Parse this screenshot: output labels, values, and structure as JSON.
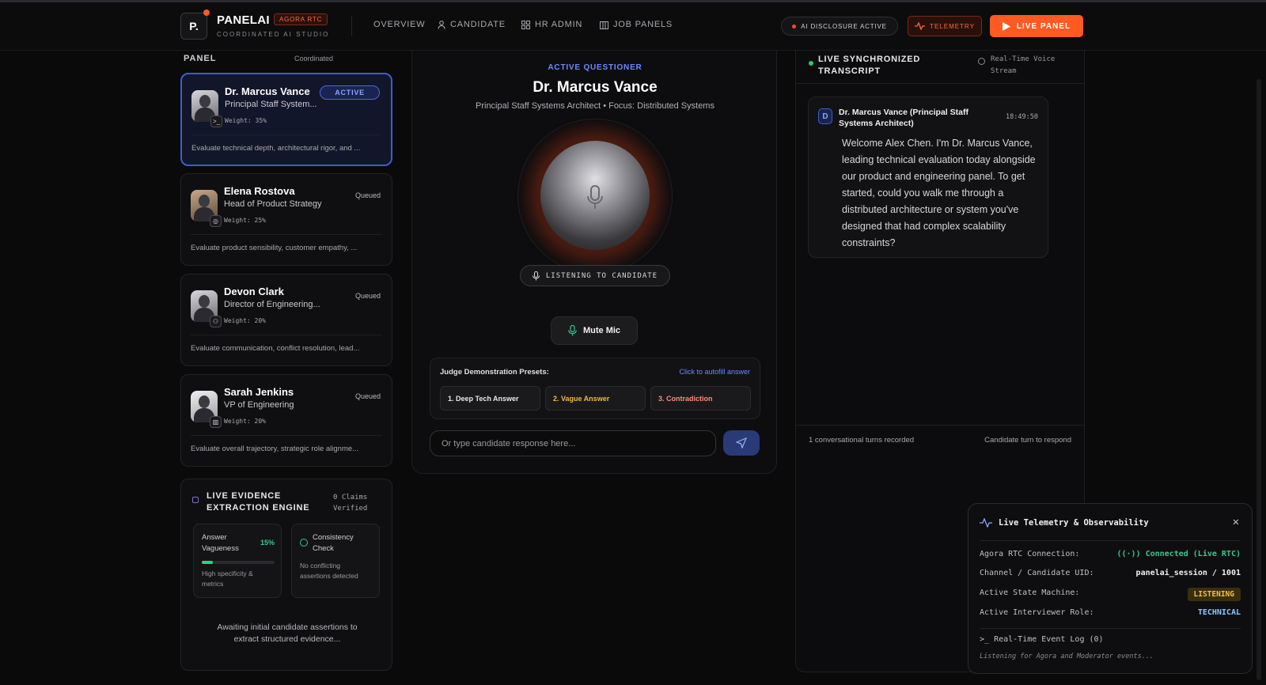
{
  "header": {
    "logo_mark": "P.",
    "brand": "PANELAI",
    "badge": "AGORA RTC",
    "subtitle": "COORDINATED AI STUDIO",
    "nav": [
      "OVERVIEW",
      "CANDIDATE",
      "HR ADMIN",
      "JOB PANELS"
    ],
    "disclosure": "AI DISCLOSURE ACTIVE",
    "telemetry_btn": "TELEMETRY",
    "live_btn": "LIVE PANEL"
  },
  "panel": {
    "title": "PANEL",
    "mode": "Coordinated",
    "members": [
      {
        "name": "Dr. Marcus Vance",
        "role": "Principal Staff System...",
        "weight": "Weight: 35%",
        "status": "ACTIVE",
        "desc": "Evaluate technical depth, architectural rigor, and ...",
        "badge_icon": "terminal-icon"
      },
      {
        "name": "Elena Rostova",
        "role": "Head of Product Strategy",
        "weight": "Weight: 25%",
        "status": "Queued",
        "desc": "Evaluate product sensibility, customer empathy, ...",
        "badge_icon": "target-icon"
      },
      {
        "name": "Devon Clark",
        "role": "Director of Engineering...",
        "weight": "Weight: 20%",
        "status": "Queued",
        "desc": "Evaluate communication, conflict resolution, lead...",
        "badge_icon": "users-icon"
      },
      {
        "name": "Sarah Jenkins",
        "role": "VP of Engineering",
        "weight": "Weight: 20%",
        "status": "Queued",
        "desc": "Evaluate overall trajectory, strategic role alignme...",
        "badge_icon": "building-icon"
      }
    ]
  },
  "evidence": {
    "title": "LIVE EVIDENCE EXTRACTION ENGINE",
    "claims": "0 Claims Verified",
    "vagueness": {
      "title": "Answer Vagueness",
      "pct": "15%",
      "fill": 15,
      "desc": "High specificity & metrics"
    },
    "consistency": {
      "title": "Consistency Check",
      "desc": "No conflicting assertions detected"
    },
    "awaiting": "Awaiting initial candidate assertions to extract structured evidence..."
  },
  "center": {
    "label": "ACTIVE QUESTIONER",
    "name": "Dr. Marcus Vance",
    "sub": "Principal Staff Systems Architect • Focus: Distributed Systems",
    "listening": "LISTENING TO CANDIDATE",
    "mute": "Mute Mic",
    "presets_title": "Judge Demonstration Presets:",
    "presets_link": "Click to autofill answer",
    "presets": [
      {
        "label": "1. Deep Tech Answer",
        "color": "#e8e8ec"
      },
      {
        "label": "2. Vague Answer",
        "color": "#f0b840"
      },
      {
        "label": "3. Contradiction",
        "color": "#ff8a7a"
      }
    ],
    "input_placeholder": "Or type candidate response here..."
  },
  "transcript": {
    "title": "LIVE SYNCHRONIZED TRANSCRIPT",
    "stream": "Real-Time Voice Stream",
    "message": {
      "avatar": "D",
      "speaker": "Dr. Marcus Vance (Principal Staff Systems Architect)",
      "time": "18:49:50",
      "text": "Welcome Alex Chen. I'm Dr. Marcus Vance, leading technical evaluation today alongside our product and engineering panel. To get started, could you walk me through a distributed architecture or system you've designed that had complex scalability constraints?"
    },
    "turns": "1 conversational turns recorded",
    "turn_status": "Candidate turn to respond"
  },
  "telemetry": {
    "title": "Live Telemetry & Observability",
    "rows": [
      {
        "label": "Agora RTC Connection:",
        "value": "Connected (Live RTC)",
        "color": "#3ac88a"
      },
      {
        "label": "Channel / Candidate UID:",
        "value": "panelai_session / 1001",
        "color": "#f0f0f0"
      },
      {
        "label": "Active State Machine:",
        "value": "LISTENING",
        "color": "#f0c040"
      },
      {
        "label": "Active Interviewer Role:",
        "value": "TECHNICAL",
        "color": "#8ac8ff"
      }
    ],
    "log_title": "Real-Time Event Log (0)",
    "log_status": "Listening for Agora and Moderator events..."
  }
}
